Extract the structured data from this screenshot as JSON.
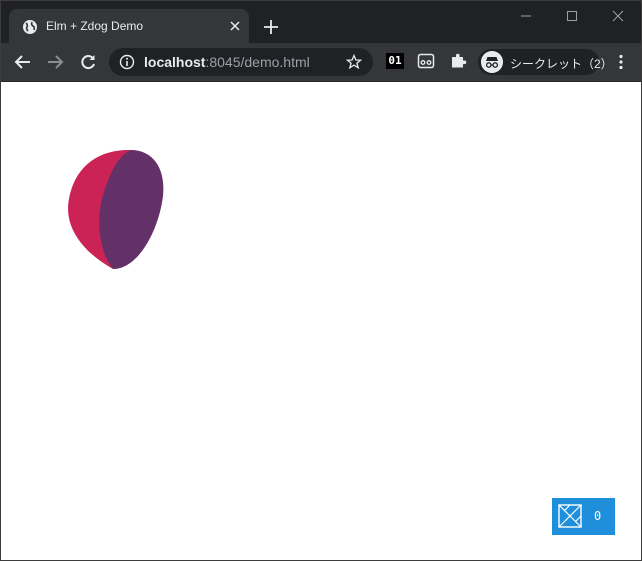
{
  "browser": {
    "tab": {
      "title": "Elm + Zdog Demo",
      "favicon": "globe-icon",
      "close_icon": "close-icon"
    },
    "new_tab_icon": "plus-icon",
    "window_controls": [
      "minimize-icon",
      "maximize-icon",
      "close-icon"
    ],
    "toolbar": {
      "back_icon": "arrow-left-icon",
      "forward_icon": "arrow-right-icon",
      "reload_icon": "reload-icon",
      "address": {
        "info_icon": "info-icon",
        "host": "localhost",
        "rest": ":8045/demo.html",
        "bookmark_icon": "star-icon"
      },
      "extensions": {
        "ext1_label": "01",
        "ext2_icon": "cassette-icon",
        "puzzle_icon": "puzzle-icon"
      },
      "incognito": {
        "icon": "incognito-icon",
        "label": "シークレット（2）"
      },
      "menu_icon": "kebab-menu-icon"
    }
  },
  "page": {
    "shape": {
      "front_color": "#633168",
      "back_color": "#cc2356"
    },
    "elm_debugger": {
      "logo": "elm-tangram-icon",
      "count": "0",
      "color": "#1f8fdb"
    }
  }
}
